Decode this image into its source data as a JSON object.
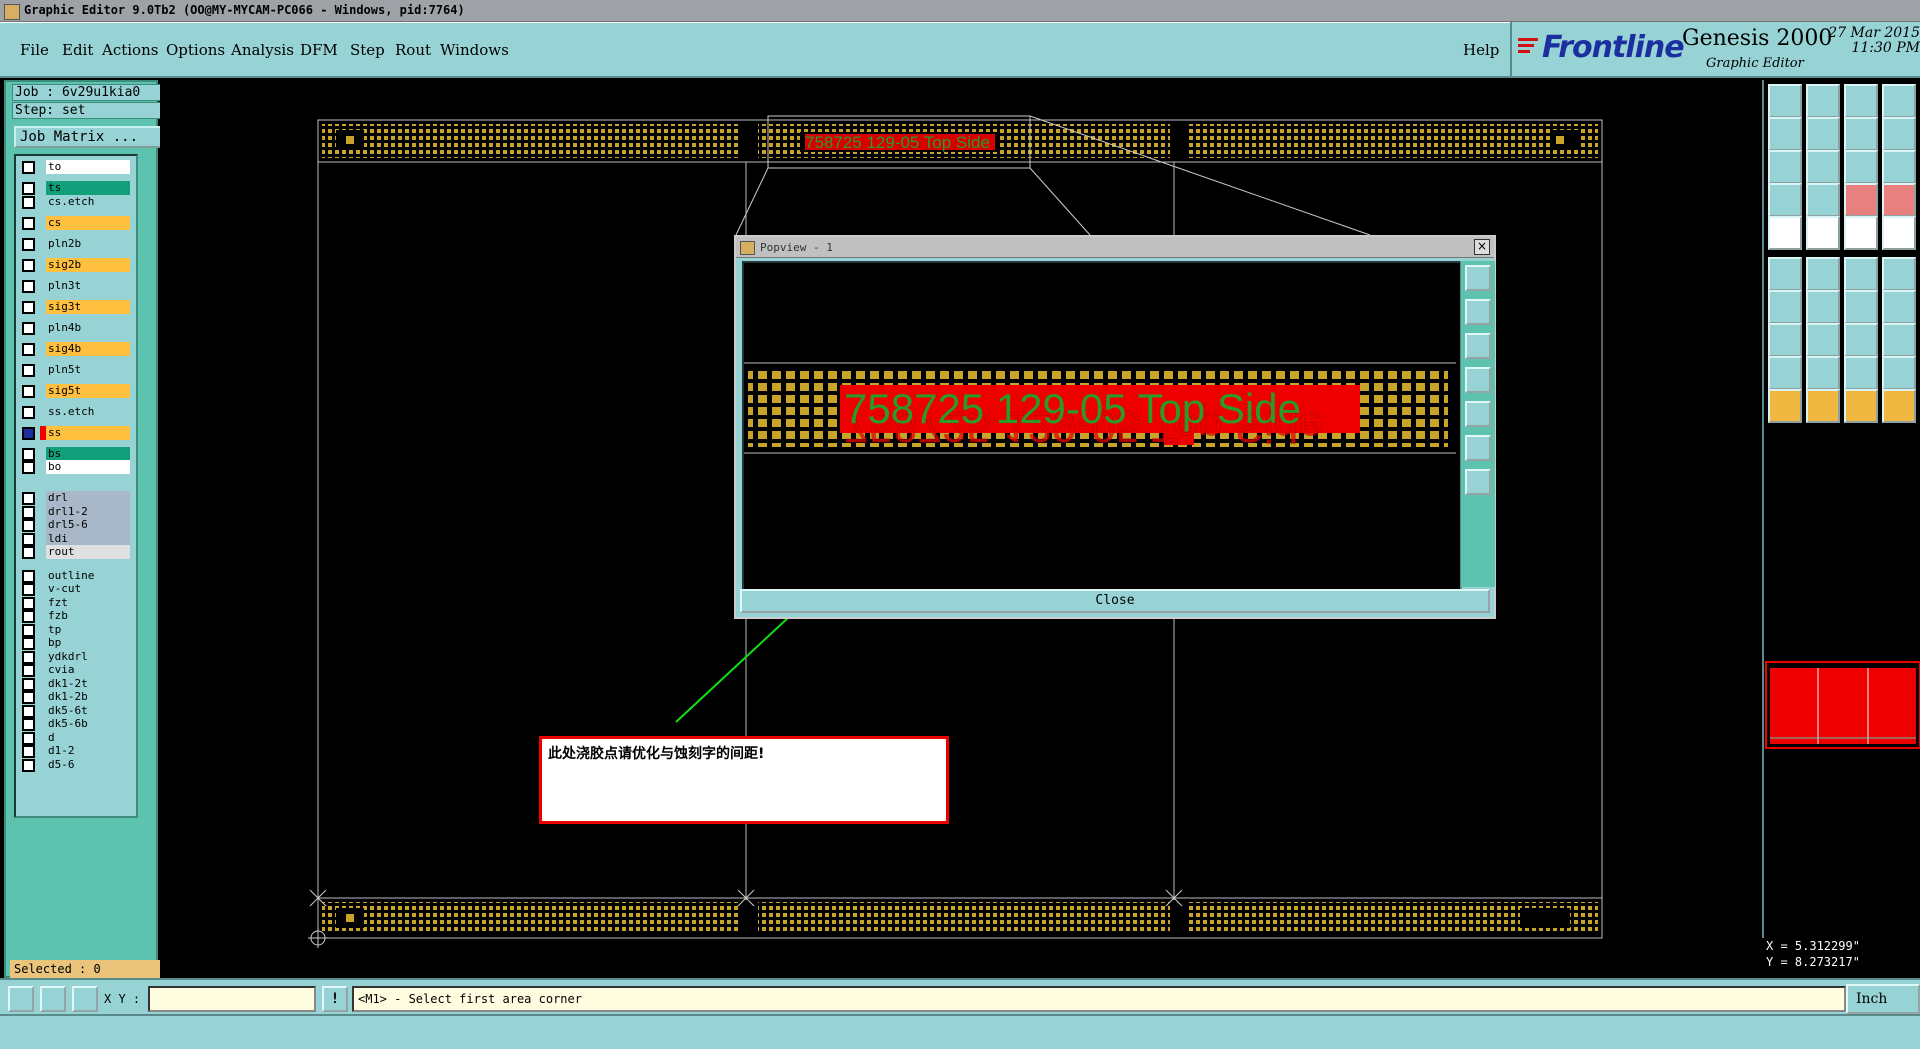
{
  "window": {
    "title": "Graphic Editor 9.0Tb2 (OO@MY-MYCAM-PC066 - Windows, pid:7764)"
  },
  "menu": {
    "items": [
      "File",
      "Edit",
      "Actions",
      "Options",
      "Analysis",
      "DFM",
      "Step",
      "Rout",
      "Windows"
    ],
    "help": "Help"
  },
  "brand": {
    "logo": "Frontline",
    "product": "Genesis 2000",
    "subtitle": "Graphic Editor",
    "date": "27 Mar 2015",
    "time": "11:30 PM"
  },
  "job": {
    "job_label": "Job : 6v29u1kia0",
    "step_label": "Step: set",
    "matrix_button": "Job Matrix ..."
  },
  "layers": [
    {
      "name": "to",
      "color": "#ffffff"
    },
    {
      "name": "ts",
      "color": "#11a07a"
    },
    {
      "name": "cs.etch",
      "color": "#97d3d5"
    },
    {
      "name": "cs",
      "color": "#ffc040"
    },
    {
      "name": "pln2b",
      "color": "#97d3d5"
    },
    {
      "name": "sig2b",
      "color": "#ffc040"
    },
    {
      "name": "pln3t",
      "color": "#97d3d5"
    },
    {
      "name": "sig3t",
      "color": "#ffc040"
    },
    {
      "name": "pln4b",
      "color": "#97d3d5"
    },
    {
      "name": "sig4b",
      "color": "#ffc040"
    },
    {
      "name": "pln5t",
      "color": "#97d3d5"
    },
    {
      "name": "sig5t",
      "color": "#ffc040"
    },
    {
      "name": "ss.etch",
      "color": "#97d3d5"
    },
    {
      "name": "ss",
      "color": "#ffc040"
    },
    {
      "name": "bs",
      "color": "#11a07a"
    },
    {
      "name": "bo",
      "color": "#ffffff"
    },
    {
      "name": "drl",
      "color": "#a8b8c8"
    },
    {
      "name": "drl1-2",
      "color": "#a8b8c8"
    },
    {
      "name": "drl5-6",
      "color": "#a8b8c8"
    },
    {
      "name": "ldi",
      "color": "#a8b8c8"
    },
    {
      "name": "rout",
      "color": "#e0e0e0"
    },
    {
      "name": "outline",
      "color": "#97d3d5"
    },
    {
      "name": "v-cut",
      "color": "#97d3d5"
    },
    {
      "name": "fzt",
      "color": "#97d3d5"
    },
    {
      "name": "fzb",
      "color": "#97d3d5"
    },
    {
      "name": "tp",
      "color": "#97d3d5"
    },
    {
      "name": "bp",
      "color": "#97d3d5"
    },
    {
      "name": "ydkdrl",
      "color": "#97d3d5"
    },
    {
      "name": "cvia",
      "color": "#97d3d5"
    },
    {
      "name": "dk1-2t",
      "color": "#97d3d5"
    },
    {
      "name": "dk1-2b",
      "color": "#97d3d5"
    },
    {
      "name": "dk5-6t",
      "color": "#97d3d5"
    },
    {
      "name": "dk5-6b",
      "color": "#97d3d5"
    },
    {
      "name": "d",
      "color": "#97d3d5"
    },
    {
      "name": "d1-2",
      "color": "#97d3d5"
    },
    {
      "name": "d5-6",
      "color": "#97d3d5"
    }
  ],
  "selected": "Selected : 0",
  "canvas": {
    "board_text": "758725 129-05 Top Side"
  },
  "popview": {
    "title": "Popview - 1",
    "zoom_text": "758725 129-05 Top Side",
    "close": "Close"
  },
  "comment": {
    "text": "此处浇胶点请优化与蚀刻字的间距!"
  },
  "coords": {
    "x": "X = 5.312299\"",
    "y": "Y = 8.273217\""
  },
  "status": {
    "xy_label": "X Y :",
    "xy_value": "",
    "message": "<M1> - Select first area corner",
    "unit": "Inch"
  },
  "colors": {
    "panel": "#97d3d5",
    "panel_dark": "#5ec3ae",
    "copper": "#c8a428",
    "etch_red": "#ff0000",
    "silk_green": "#30a030"
  }
}
